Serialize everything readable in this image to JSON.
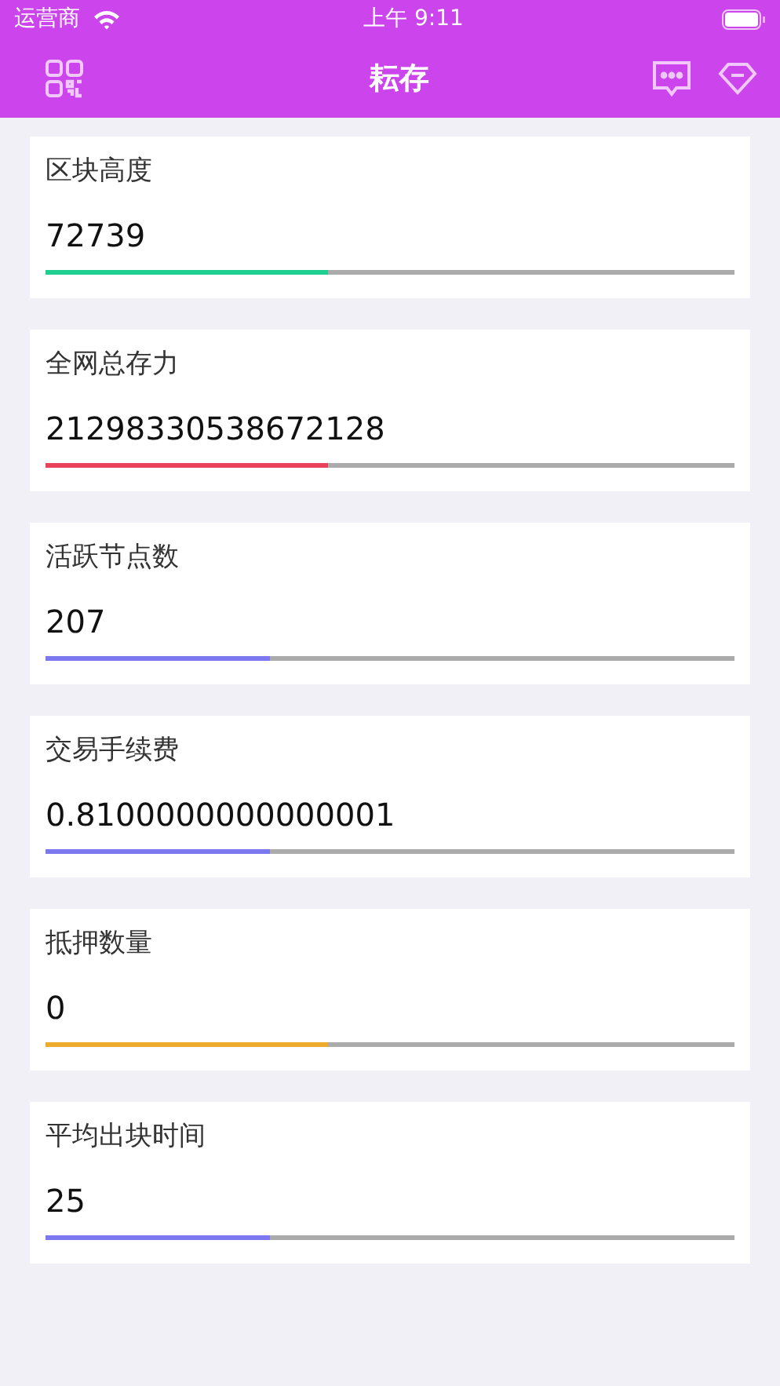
{
  "status_bar": {
    "carrier": "运营商",
    "time": "上午 9:11"
  },
  "nav": {
    "title": "耘存"
  },
  "stats": [
    {
      "label": "区块高度",
      "value": "72739",
      "level": 0.41,
      "color": "#20cf90"
    },
    {
      "label": "全网总存力",
      "value": "21298330538672128",
      "level": 0.41,
      "color": "#e8435a"
    },
    {
      "label": "活跃节点数",
      "value": "207",
      "level": 0.325,
      "color": "#7b78f0"
    },
    {
      "label": "交易手续费",
      "value": "0.8100000000000001",
      "level": 0.325,
      "color": "#7b78f0"
    },
    {
      "label": "抵押数量",
      "value": "0",
      "level": 0.41,
      "color": "#eeab2b"
    },
    {
      "label": "平均出块时间",
      "value": "25",
      "level": 0.325,
      "color": "#7b78f0"
    }
  ]
}
